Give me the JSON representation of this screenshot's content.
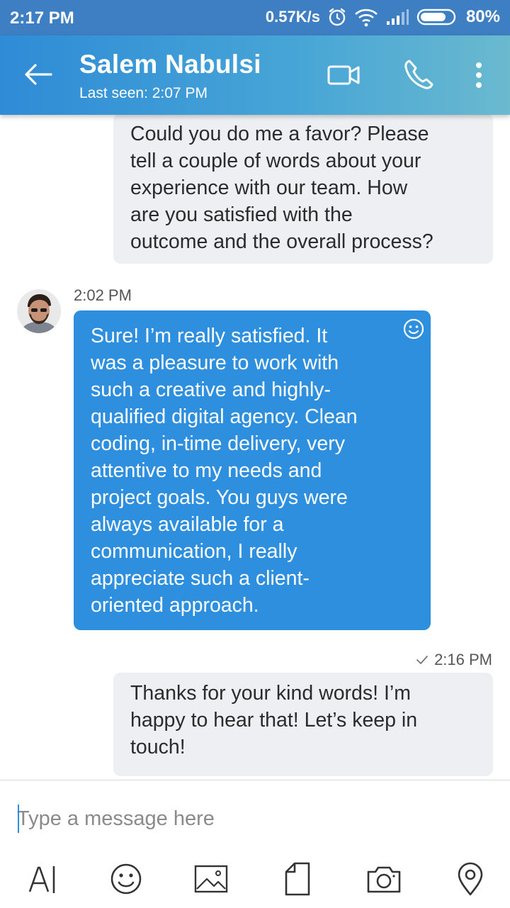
{
  "status_bar": {
    "time": "2:17 PM",
    "network_speed": "0.57K/s",
    "battery": "80%",
    "battery_level": 0.8,
    "icons": [
      "alarm-icon",
      "wifi-icon",
      "signal-icon",
      "battery-icon"
    ]
  },
  "header": {
    "contact_name": "Salem Nabulsi",
    "last_seen": "Last seen: 2:07 PM",
    "actions": [
      "back-arrow-icon",
      "video-call-icon",
      "phone-icon",
      "more-vertical-icon"
    ]
  },
  "messages": [
    {
      "direction": "outgoing",
      "lines": [
        "Could you do me a favor? Please",
        "tell a couple of words about your",
        "experience with our team. How",
        "are you satisfied with the",
        "outcome and the overall process?"
      ]
    },
    {
      "direction": "incoming",
      "time": "2:02 PM",
      "lines": [
        "Sure! I’m really satisfied. It",
        "was a pleasure to work with",
        "such a creative and highly-",
        "qualified digital agency. Clean",
        "coding, in-time delivery, very",
        "attentive to my needs and",
        "project goals. You guys were",
        "always available for a",
        "communication, I really",
        "appreciate such a client-",
        "oriented approach."
      ]
    },
    {
      "direction": "outgoing",
      "time": "2:16 PM",
      "delivered": true,
      "lines": [
        "Thanks for your kind words! I’m",
        "happy to hear that! Let’s keep in",
        "touch!"
      ]
    }
  ],
  "composer": {
    "placeholder": "Type a message here",
    "value": "",
    "tools": [
      "text-format-icon",
      "emoji-icon",
      "image-icon",
      "file-icon",
      "camera-icon",
      "location-icon"
    ]
  },
  "colors": {
    "accent": "#2d8fde",
    "header_start": "#2f8bd6",
    "header_end": "#6ab9cf",
    "outgoing_bubble": "#eeeff2",
    "incoming_bubble": "#2d8fde"
  }
}
